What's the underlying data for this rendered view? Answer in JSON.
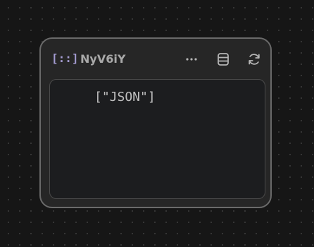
{
  "node": {
    "icon_name": "grid-dots-bracket-icon",
    "icon_glyph": "[::]",
    "title": "NyV6iY",
    "actions": [
      {
        "name": "more-icon"
      },
      {
        "name": "database-icon"
      },
      {
        "name": "refresh-icon"
      }
    ],
    "output": "[\"JSON\"]"
  },
  "colors": {
    "background": "#161616",
    "node_background": "#262626",
    "node_border": "#6a6a6a",
    "accent": "#a39bd0",
    "text": "#bfbfbf"
  }
}
